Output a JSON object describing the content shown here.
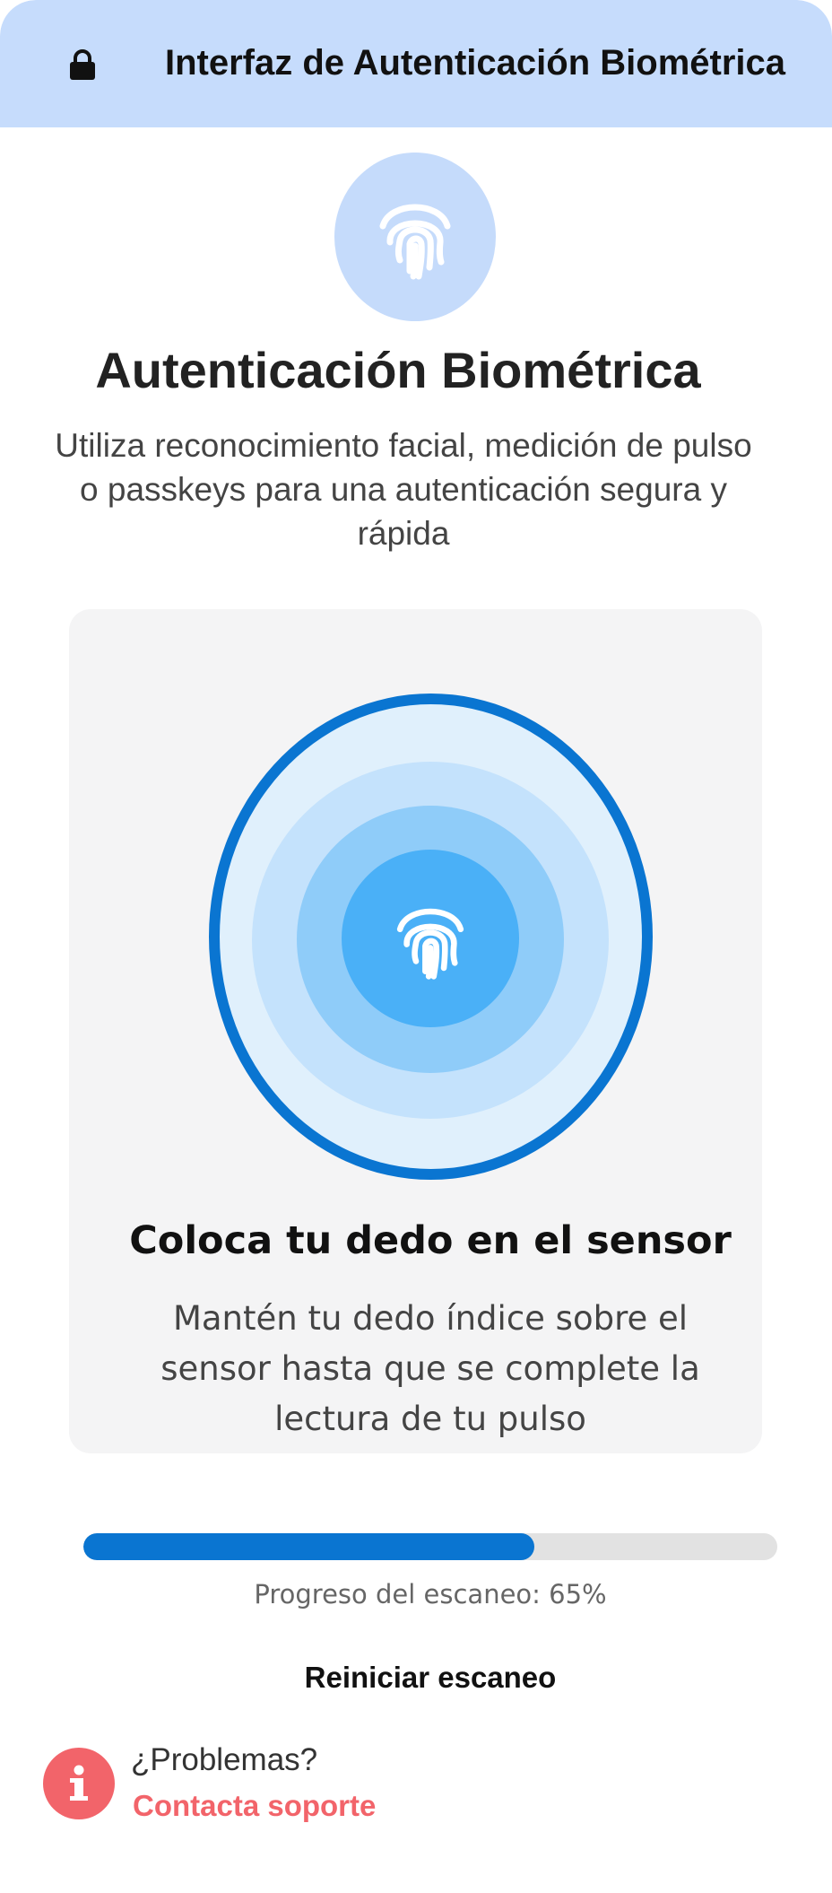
{
  "header": {
    "title": "Interfaz de Autenticación Biométrica",
    "icon": "lock-icon"
  },
  "hero": {
    "icon": "fingerprint-icon",
    "title": "Autenticación Biométrica",
    "subtitle": "Utiliza reconocimiento facial, medición de pulso o passkeys para una autenticación segura y rápida"
  },
  "scanner": {
    "icon": "fingerprint-icon",
    "instruction_title": "Coloca tu dedo en el sensor",
    "instruction_text": "Mantén tu dedo índice sobre el sensor hasta que se complete la lectura de tu pulso"
  },
  "progress": {
    "percent": 65,
    "label": "Progreso del escaneo: 65%"
  },
  "actions": {
    "restart_label": "Reiniciar escaneo"
  },
  "help": {
    "icon": "info-icon",
    "question": "¿Problemas?",
    "link_label": "Contacta soporte"
  },
  "colors": {
    "header_bg": "#c6dcfc",
    "accent": "#0a75d1",
    "danger": "#f2646a",
    "card_bg": "#f4f4f5"
  }
}
